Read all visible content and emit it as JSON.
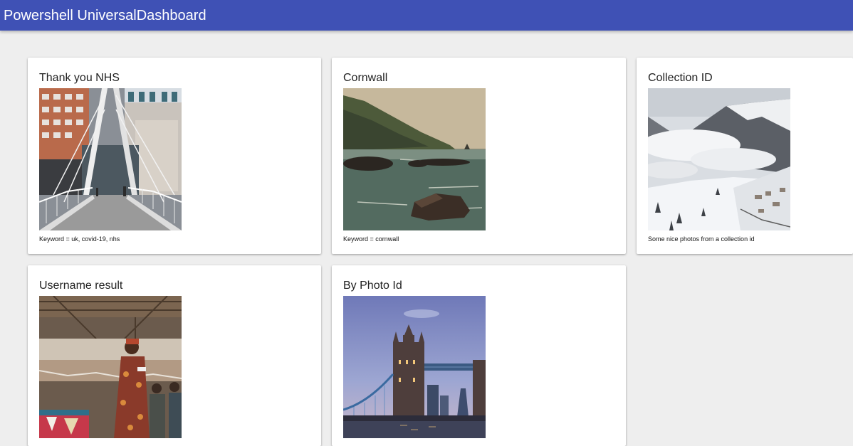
{
  "app": {
    "title": "Powershell UniversalDashboard"
  },
  "cards": [
    {
      "title": "Thank you NHS",
      "caption": "Keyword = uk, covid-19, nhs",
      "image": "footbridge-buildings-photo"
    },
    {
      "title": "Cornwall",
      "caption": "Keyword = cornwall",
      "image": "rocky-coast-photo"
    },
    {
      "title": "Collection ID",
      "caption": "Some nice photos from a collection id",
      "image": "snowy-mountain-valley-photo"
    },
    {
      "title": "Username result",
      "caption": "",
      "image": "woman-speaking-in-shed-photo"
    },
    {
      "title": "By Photo Id",
      "caption": "",
      "image": "tower-bridge-dusk-photo"
    }
  ],
  "colors": {
    "appbar": "#3f51b5",
    "background": "#eeeeee",
    "card": "#ffffff"
  }
}
